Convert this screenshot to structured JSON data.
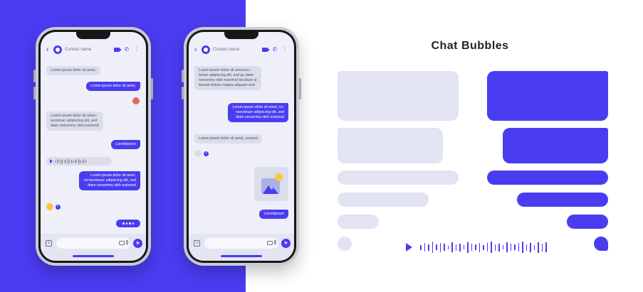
{
  "colors": {
    "accent": "#4a3cf0",
    "bubble_gray": "#e2e3f3",
    "screen_bg": "#eeeff8"
  },
  "title": "Chat Bubbles",
  "phone_left": {
    "contact_name": "Contact name",
    "messages": [
      "Lorem ipsum dolor sit amet,",
      "Lorem ipsum dolor sit amet,",
      "Lorem ipsum dolor sit amec-\nsectetuer adipiscing elit, sed\ndiam nonummy nibh euismod",
      "Loremipsum",
      "Lorem ipsum dolor sit amet,\nconsectetuer adipiscing elit, sed\ndiam nonummy nibh euismod"
    ]
  },
  "phone_right": {
    "contact_name": "Contact name",
    "messages": [
      "Lorem ipsum dolor sit amecsec-\ntetuer adipiscing elit, sed go diam\nnonummy nibh euismod tincidunt ut\nlaoreet dolore magna aliquam erat",
      "Lorem ipsum dolor sit amet, co-\nnsectetuer adipiscing elit, sed\ndiam nonummy nibh euismod",
      "Lorem ipsum dolor sit amet, consect",
      "Loremipsum"
    ]
  },
  "icons": [
    "back-arrow-icon",
    "avatar-icon",
    "video-call-icon",
    "phone-icon",
    "more-icon",
    "play-icon",
    "check-icon",
    "image-icon",
    "plus-icon",
    "camera-icon",
    "microphone-icon",
    "send-icon"
  ]
}
